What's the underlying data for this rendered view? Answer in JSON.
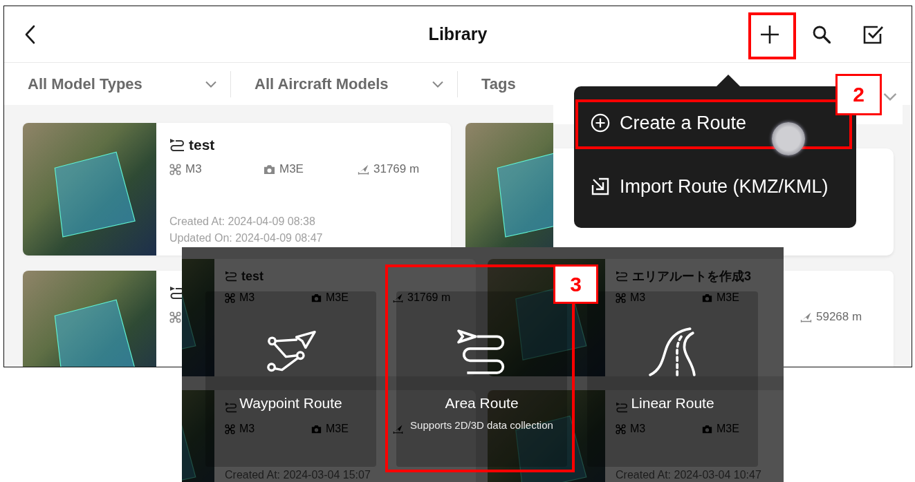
{
  "library": {
    "header": {
      "title": "Library",
      "actions": [
        {
          "kind": "add",
          "highlighted": true
        },
        {
          "kind": "search",
          "highlighted": false
        },
        {
          "kind": "select",
          "highlighted": false
        }
      ]
    },
    "filters": [
      {
        "label": "All Model Types",
        "dropdown": true
      },
      {
        "label": "All Aircraft Models",
        "dropdown": true
      },
      {
        "label": "Tags",
        "dropdown": false
      }
    ],
    "routes": [
      {
        "thumbnail": true,
        "title": "test",
        "aircraft": "M3",
        "camera": "M3E",
        "distance": "31769 m",
        "created": "Created At: 2024-04-09 08:38",
        "updated": "Updated On: 2024-04-09 08:47"
      },
      {
        "thumbnail": true
      },
      {
        "thumbnail": true,
        "title_icon": true,
        "aircraft_icon": true
      },
      {
        "distance": "59268 m"
      }
    ]
  },
  "create_menu": {
    "items": [
      {
        "kind": "create",
        "label": "Create a Route",
        "highlighted": true,
        "touched": true,
        "callout": "2"
      },
      {
        "kind": "import",
        "label": "Import Route (KMZ/KML)",
        "highlighted": false,
        "touched": false
      }
    ]
  },
  "route_type_picker": {
    "background_routes": [
      {
        "thumbnail": true,
        "title": "test",
        "aircraft": "M3",
        "camera": "M3E",
        "distance": "31769 m"
      },
      {
        "thumbnail": true,
        "title": "エリアルートを作成3",
        "aircraft": "M3",
        "camera": "M3E"
      },
      {
        "thumbnail": true,
        "title_icon": true,
        "aircraft": "M3",
        "camera": "M3E",
        "distance_icon": true,
        "created": "Created At: 2024-03-04 15:07"
      },
      {
        "thumbnail": true,
        "title_icon": true,
        "aircraft": "M3",
        "camera": "M3E",
        "created": "Created At: 2024-03-04 10:47"
      }
    ],
    "options": [
      {
        "kind": "waypoint",
        "label": "Waypoint Route",
        "highlighted": false
      },
      {
        "kind": "area",
        "label": "Area Route",
        "subtitle": "Supports 2D/3D data collection",
        "highlighted": true,
        "callout": "3"
      },
      {
        "kind": "linear",
        "label": "Linear Route",
        "highlighted": false
      }
    ]
  }
}
